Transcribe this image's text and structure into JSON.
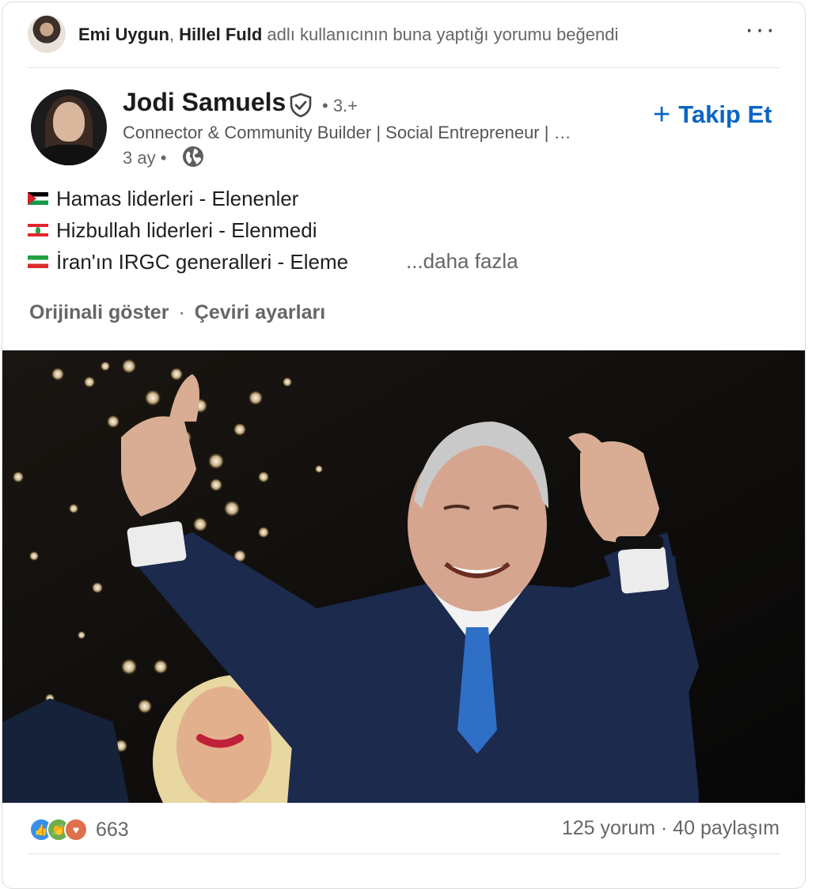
{
  "activity": {
    "actor_1": "Emi Uygun",
    "separator": ",",
    "actor_2": "Hillel Fuld",
    "action_text": "adlı kullanıcının buna yaptığı yorumu beğendi"
  },
  "author": {
    "name": "Jodi Samuels",
    "degree": "• 3.+",
    "headline": "Connector & Community Builder | Social Entrepreneur | …",
    "time": "3 ay •"
  },
  "follow_button": {
    "label": "Takip Et"
  },
  "post": {
    "lines": [
      {
        "flag": "palestine-flag",
        "text": "Hamas liderleri - Elenenler"
      },
      {
        "flag": "lebanon-flag",
        "text": "Hizbullah liderleri - Elenmedi"
      },
      {
        "flag": "iran-flag",
        "text": "İran'ın IRGC generalleri - Eleme"
      }
    ],
    "see_more": "...daha fazla"
  },
  "translation": {
    "show_original": "Orijinali göster",
    "separator": "·",
    "settings": "Çeviri ayarları"
  },
  "social": {
    "reaction_count": "663",
    "comments": "125 yorum",
    "separator": "·",
    "shares": "40 paylaşım"
  },
  "colors": {
    "accent": "#0a66c2",
    "like": "#378fe9",
    "celebrate": "#6dae4f",
    "love": "#df704d"
  }
}
